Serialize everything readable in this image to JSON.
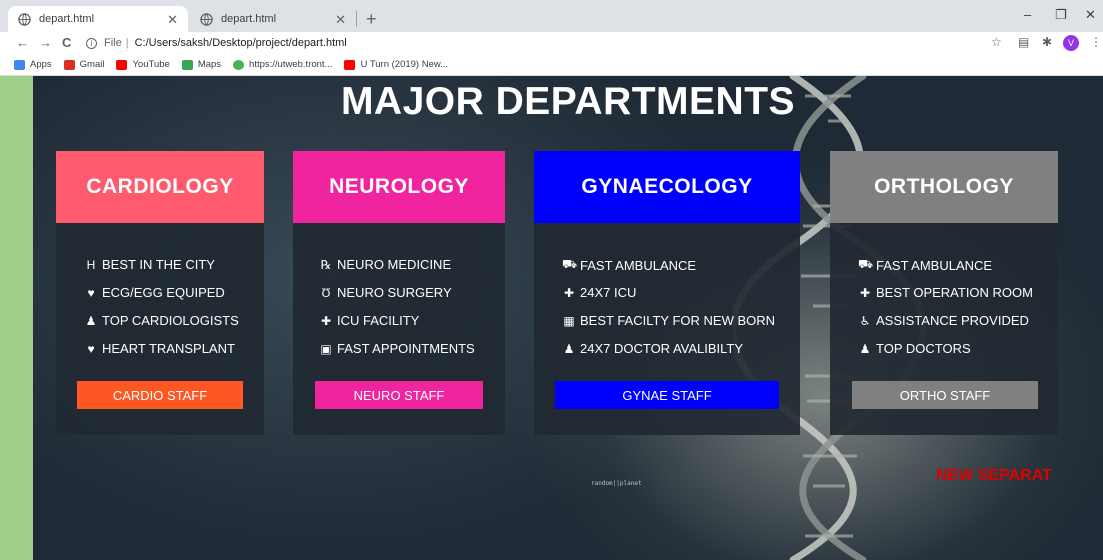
{
  "browser": {
    "tabs": [
      {
        "title": "depart.html",
        "active": true
      },
      {
        "title": "depart.html",
        "active": false
      }
    ],
    "new_tab": "+",
    "window_controls": {
      "minimize": "–",
      "maximize": "❐",
      "close": "✕"
    },
    "nav": {
      "back": "←",
      "forward": "→",
      "reload": "C"
    },
    "address": {
      "scheme": "File",
      "separator": "|",
      "path": "C:/Users/saksh/Desktop/project/depart.html"
    },
    "toolbar_icons": {
      "star": "☆",
      "reader": "▤",
      "extensions": "✱",
      "menu": "⋮"
    },
    "profile_initial": "V",
    "bookmarks": [
      {
        "label": "Apps",
        "icon": "apps-grid-icon",
        "color": "#4285f4"
      },
      {
        "label": "Gmail",
        "icon": "gmail-icon",
        "color": "#d93025"
      },
      {
        "label": "YouTube",
        "icon": "youtube-icon",
        "color": "#ff0000"
      },
      {
        "label": "Maps",
        "icon": "maps-icon",
        "color": "#34a853"
      },
      {
        "label": "https://utweb.tront...",
        "icon": "utweb-icon",
        "color": "#4caf50"
      },
      {
        "label": "U Turn (2019) New...",
        "icon": "youtube-icon",
        "color": "#ff0000"
      }
    ]
  },
  "page": {
    "title": "MAJOR DEPARTMENTS",
    "departments": [
      {
        "name": "CARDIOLOGY",
        "color": "#ff5a6e",
        "staff_color": "#ff5722",
        "features": [
          {
            "icon": "hospital-icon",
            "glyph": "H",
            "label": "BEST IN THE CITY"
          },
          {
            "icon": "heartbeat-icon",
            "glyph": "♥",
            "label": "ECG/EGG EQUIPED"
          },
          {
            "icon": "user-doctor-icon",
            "glyph": "♟",
            "label": "TOP CARDIOLOGISTS"
          },
          {
            "icon": "heart-icon",
            "glyph": "♥",
            "label": "HEART TRANSPLANT"
          }
        ],
        "staff_label": "CARDIO STAFF"
      },
      {
        "name": "NEUROLOGY",
        "color": "#f0249e",
        "staff_color": "#f0249e",
        "features": [
          {
            "icon": "prescription-icon",
            "glyph": "℞",
            "label": "NEURO MEDICINE"
          },
          {
            "icon": "stethoscope-icon",
            "glyph": "Ʊ",
            "label": "NEURO SURGERY"
          },
          {
            "icon": "plus-square-icon",
            "glyph": "✚",
            "label": "ICU FACILITY"
          },
          {
            "icon": "medkit-icon",
            "glyph": "▣",
            "label": "FAST APPOINTMENTS"
          }
        ],
        "staff_label": "NEURO STAFF"
      },
      {
        "name": "GYNAECOLOGY",
        "color": "#0000ff",
        "staff_color": "#0000ff",
        "features": [
          {
            "icon": "ambulance-icon",
            "glyph": "⛟",
            "label": "FAST AMBULANCE"
          },
          {
            "icon": "plus-square-icon",
            "glyph": "✚",
            "label": "24X7 ICU"
          },
          {
            "icon": "clinic-building-icon",
            "glyph": "▦",
            "label": "BEST FACILTY FOR NEW BORN"
          },
          {
            "icon": "user-doctor-icon",
            "glyph": "♟",
            "label": "24X7 DOCTOR AVALIBILTY"
          }
        ],
        "staff_label": "GYNAE STAFF"
      },
      {
        "name": "ORTHOLOGY",
        "color": "#808080",
        "staff_color": "#808080",
        "features": [
          {
            "icon": "ambulance-icon",
            "glyph": "⛟",
            "label": "FAST AMBULANCE"
          },
          {
            "icon": "plus-square-icon",
            "glyph": "✚",
            "label": "BEST OPERATION ROOM"
          },
          {
            "icon": "wheelchair-icon",
            "glyph": "♿",
            "label": "ASSISTANCE PROVIDED"
          },
          {
            "icon": "user-doctor-icon",
            "glyph": "♟",
            "label": "TOP DOCTORS"
          }
        ],
        "staff_label": "ORTHO STAFF"
      }
    ],
    "watermark": "random||planet",
    "new_separator": "NEW SEPARAT"
  }
}
